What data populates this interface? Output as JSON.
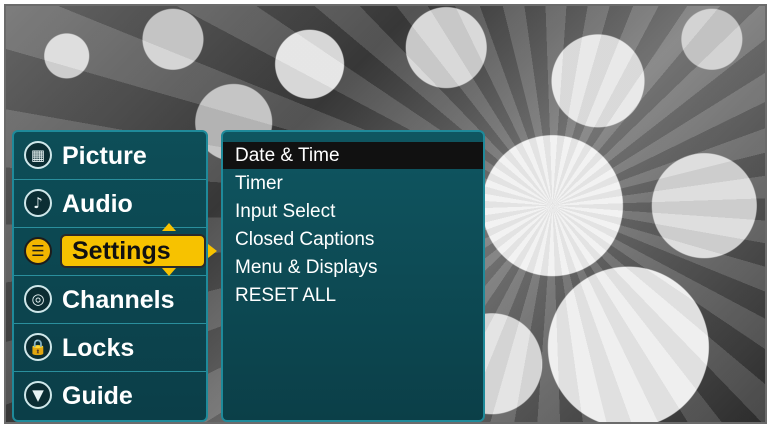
{
  "main_menu": {
    "items": [
      {
        "label": "Picture",
        "icon": "picture-icon",
        "glyph": "▦"
      },
      {
        "label": "Audio",
        "icon": "audio-icon",
        "glyph": "♪"
      },
      {
        "label": "Settings",
        "icon": "settings-icon",
        "glyph": "☰"
      },
      {
        "label": "Channels",
        "icon": "channels-icon",
        "glyph": "◎"
      },
      {
        "label": "Locks",
        "icon": "lock-icon",
        "glyph": "🔒"
      },
      {
        "label": "Guide",
        "icon": "guide-icon",
        "glyph": "▼"
      }
    ],
    "active_index": 2
  },
  "settings_submenu": {
    "items": [
      "Date & Time",
      "Timer",
      "Input Select",
      "Closed Captions",
      "Menu & Displays",
      "RESET ALL"
    ],
    "selected_index": 0
  },
  "colors": {
    "menu_background": "#0d4e58",
    "accent_highlight": "#f7c200",
    "selected_row": "#111111"
  }
}
